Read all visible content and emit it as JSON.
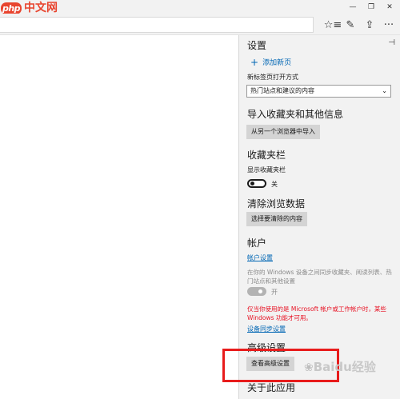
{
  "logo": {
    "badge": "php",
    "text": "中文网"
  },
  "window_controls": {
    "minimize": "—",
    "restore": "❐",
    "close": "✕"
  },
  "toolbar": {
    "reading_list_icon": "☆≡",
    "notes_icon": "✎",
    "share_icon": "⇪",
    "more_icon": "···"
  },
  "settings": {
    "title": "设置",
    "pin_icon": "⊣",
    "add_new_tab": "添加新页",
    "new_tab_open_label": "新标签页打开方式",
    "new_tab_select_value": "热门站点和建议的内容",
    "import": {
      "title": "导入收藏夹和其他信息",
      "button": "从另一个浏览器中导入"
    },
    "favorites_bar": {
      "title": "收藏夹栏",
      "show_label": "显示收藏夹栏",
      "toggle_state": "关"
    },
    "clear_data": {
      "title": "清除浏览数据",
      "button": "选择要清除的内容"
    },
    "account": {
      "title": "帐户",
      "link": "帐户设置",
      "description": "在你的 Windows 设备之间同步收藏夹、阅读列表、热门站点和其他设置",
      "toggle_state": "开",
      "warning": "仅当你使用的是 Microsoft 帐户或工作帐户时，某些 Windows 功能才可用。",
      "sync_link": "设备同步设置"
    },
    "advanced": {
      "title": "高级设置",
      "button": "查看高级设置"
    },
    "about": {
      "title": "关于此应用"
    }
  },
  "watermark": {
    "text": "Baidu经验"
  },
  "colors": {
    "link": "#0066b4",
    "warning": "#e81123",
    "highlight": "#e81c1c",
    "logo": "#e8442e"
  }
}
